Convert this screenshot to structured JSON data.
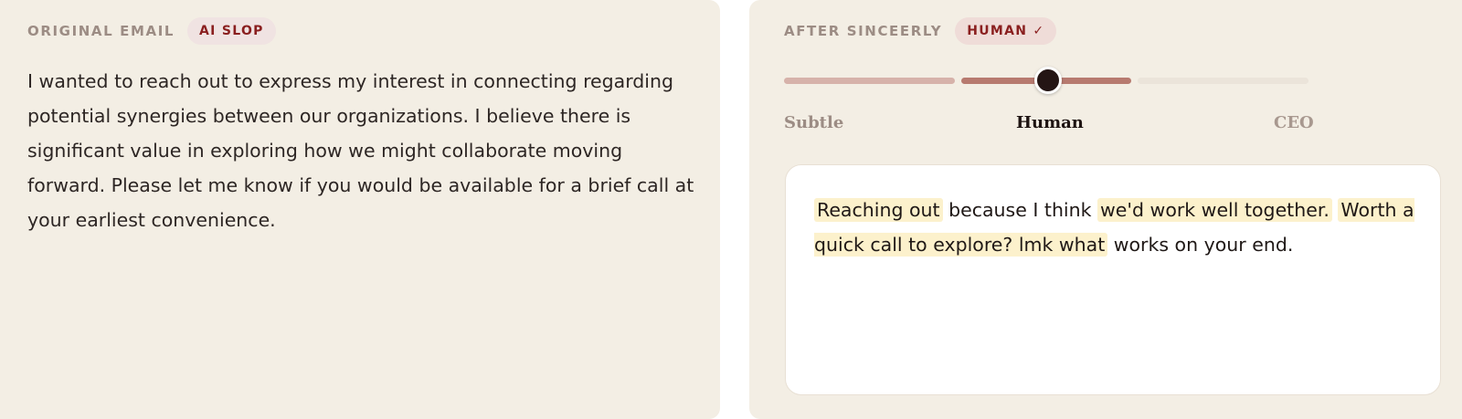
{
  "left_panel": {
    "eyebrow": "ORIGINAL EMAIL",
    "badge": "AI SLOP",
    "body": "I wanted to reach out to express my interest in connecting regarding potential synergies between our organizations. I believe there is significant value in exploring how we might collaborate moving forward. Please let me know if you would be available for a brief call at your earliest convenience."
  },
  "right_panel": {
    "eyebrow": "AFTER SINCEERLY",
    "badge": "HUMAN ✓",
    "slider": {
      "levels": [
        "Subtle",
        "Human",
        "CEO"
      ],
      "selected": "Human",
      "selected_index": 1
    },
    "output_segments": [
      {
        "text": "Reaching out",
        "highlight": true
      },
      {
        "text": " because I think ",
        "highlight": false
      },
      {
        "text": "we'd work well together.",
        "highlight": true
      },
      {
        "text": " ",
        "highlight": false
      },
      {
        "text": "Worth a quick call to explore? lmk what",
        "highlight": true
      },
      {
        "text": " works on your end.",
        "highlight": false
      }
    ]
  },
  "colors": {
    "panel_bg": "#f3eee4",
    "badge_text": "#8a1f1f",
    "highlight": "#fcf1cc",
    "slider_active": "#b77a6f",
    "knob": "#241514"
  }
}
